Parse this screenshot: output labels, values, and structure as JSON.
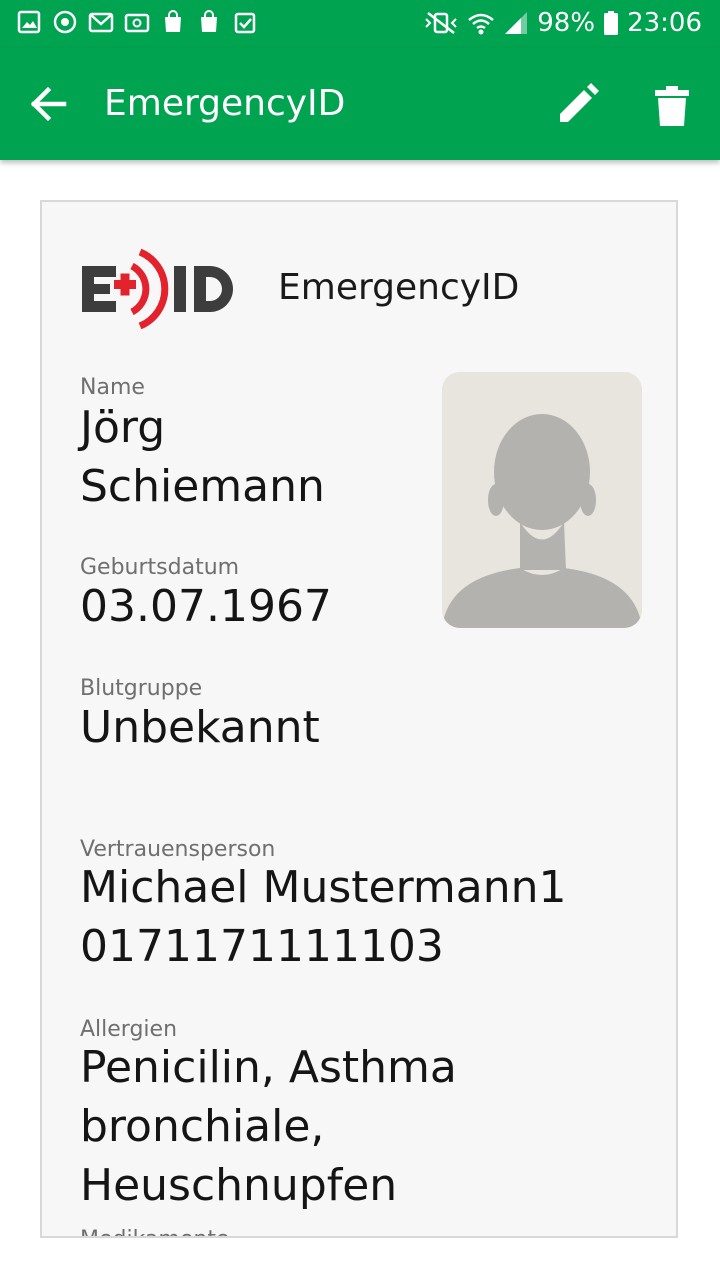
{
  "status_bar": {
    "battery_percent": "98%",
    "time": "23:06",
    "left_icons": [
      "gallery-icon",
      "sync-icon",
      "gmail-icon",
      "email-icon",
      "galaxy-store-icon",
      "galaxy-store-icon",
      "clipboard-check-icon"
    ],
    "right_icons": [
      "vibrate-icon",
      "wifi-icon",
      "signal-icon",
      "battery-icon"
    ]
  },
  "app_bar": {
    "title": "EmergencyID",
    "back_icon": "arrow-back-icon",
    "edit_icon": "pencil-icon",
    "delete_icon": "trash-icon"
  },
  "card": {
    "brand_name": "EmergencyID",
    "logo_text": "E+ID",
    "fields": {
      "name": {
        "label": "Name",
        "value": "Jörg Schiemann"
      },
      "birth": {
        "label": "Geburtsdatum",
        "value": "03.07.1967"
      },
      "blood": {
        "label": "Blutgruppe",
        "value": "Unbekannt"
      },
      "contact": {
        "label": "Vertrauensperson",
        "value_name": "Michael Mustermann1",
        "value_phone": "0171171111103"
      },
      "allergies": {
        "label": "Allergien",
        "value_line1": "Penicilin, Asthma",
        "value_line2": "bronchiale,",
        "value_line3": "Heuschnupfen"
      },
      "medication": {
        "label": "Medikamente"
      }
    },
    "photo_placeholder": "person-silhouette-icon"
  },
  "colors": {
    "primary": "#00a350",
    "logo_gray": "#3d3d3d",
    "logo_red": "#e2232e"
  }
}
